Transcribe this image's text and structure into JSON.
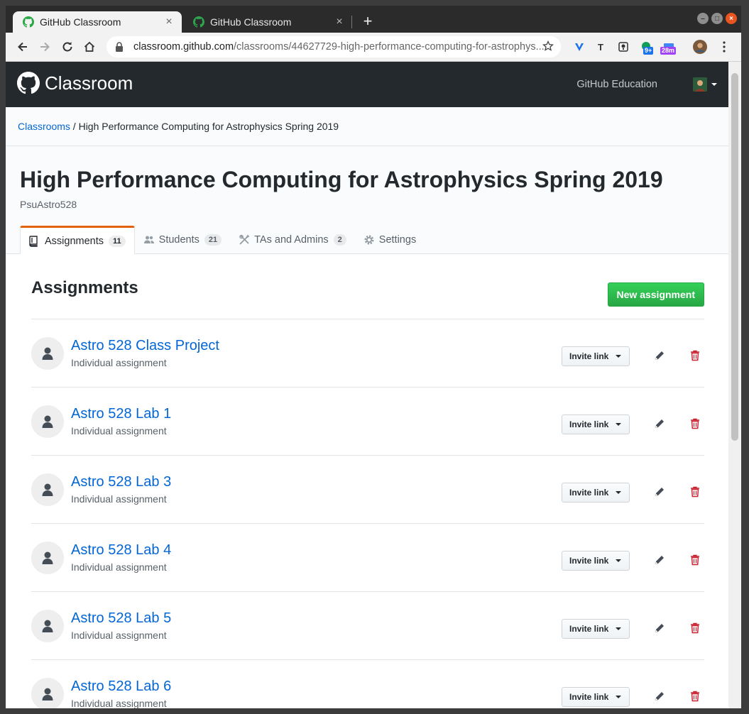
{
  "browser": {
    "tabs": [
      {
        "title": "GitHub Classroom",
        "close": "×"
      },
      {
        "title": "GitHub Classroom",
        "close": "×"
      }
    ],
    "new_tab": "+",
    "url_host": "classroom.github.com",
    "url_path": "/classrooms/44627729-high-performance-computing-for-astrophys...",
    "extensions": [
      {
        "name": "v-extension-icon"
      },
      {
        "name": "t-extension-icon",
        "label": "T"
      },
      {
        "name": "lightbulb-extension-icon"
      },
      {
        "name": "hangouts-extension-icon",
        "badge": "9+"
      },
      {
        "name": "calendar-extension-icon",
        "badge": "28m"
      },
      {
        "name": "profile-avatar"
      }
    ]
  },
  "header": {
    "brand": "Classroom",
    "education_link": "GitHub Education"
  },
  "breadcrumb": {
    "root": "Classrooms",
    "separator": " / ",
    "current": "High Performance Computing for Astrophysics Spring 2019"
  },
  "classroom": {
    "title": "High Performance Computing for Astrophysics Spring 2019",
    "org": "PsuAstro528"
  },
  "tabs": [
    {
      "label": "Assignments",
      "count": "11",
      "icon": "book-icon"
    },
    {
      "label": "Students",
      "count": "21",
      "icon": "people-icon"
    },
    {
      "label": "TAs and Admins",
      "count": "2",
      "icon": "tools-icon"
    },
    {
      "label": "Settings",
      "icon": "gear-icon"
    }
  ],
  "assignments_section": {
    "title": "Assignments",
    "new_button": "New assignment",
    "items": [
      {
        "title": "Astro 528 Class Project",
        "type": "Individual assignment",
        "invite": "Invite link"
      },
      {
        "title": "Astro 528 Lab 1",
        "type": "Individual assignment",
        "invite": "Invite link"
      },
      {
        "title": "Astro 528 Lab 3",
        "type": "Individual assignment",
        "invite": "Invite link"
      },
      {
        "title": "Astro 528 Lab 4",
        "type": "Individual assignment",
        "invite": "Invite link"
      },
      {
        "title": "Astro 528 Lab 5",
        "type": "Individual assignment",
        "invite": "Invite link"
      },
      {
        "title": "Astro 528 Lab 6",
        "type": "Individual assignment",
        "invite": "Invite link"
      }
    ]
  },
  "colors": {
    "header_bg": "#24292e",
    "link": "#0366d6",
    "tab_accent": "#e36209",
    "primary_button": "#28a745",
    "delete_icon": "#cb2431"
  }
}
